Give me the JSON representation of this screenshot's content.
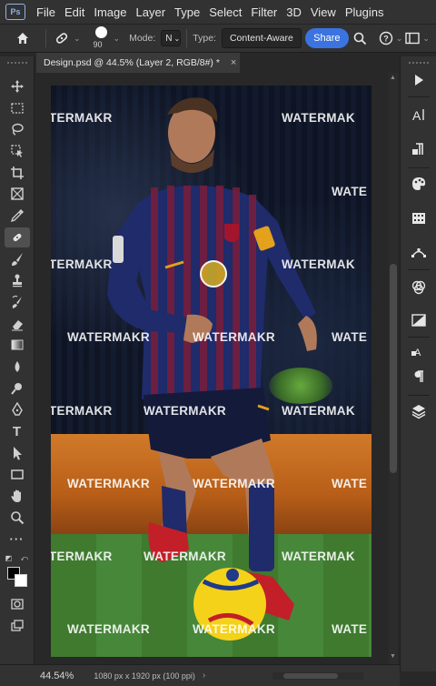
{
  "menubar": {
    "app_icon": "photoshop-logo",
    "items": [
      "File",
      "Edit",
      "Image",
      "Layer",
      "Type",
      "Select",
      "Filter",
      "3D",
      "View",
      "Plugins"
    ]
  },
  "options": {
    "brush_size": "90",
    "mode_label": "Mode:",
    "mode_value": "N",
    "type_label": "Type:",
    "type_value": "Content-Aware",
    "share_label": "Share"
  },
  "document": {
    "tab_title": "Design.psd @ 44.5% (Layer 2, RGB/8#) *",
    "close_glyph": "×"
  },
  "canvas": {
    "watermarks": [
      "TERMAKR",
      "WATERMAK",
      "WATE",
      "TERMAKR",
      "WATERMAK",
      "WATERMAKR",
      "WATERMAKR",
      "WATE",
      "TERMAKR",
      "WATERMAKR",
      "WATERMAK",
      "WATERMAKR",
      "WATERMAKR",
      "WATE",
      "TERMAKR",
      "WATERMAKR",
      "WATERMAK",
      "WATERMAKR",
      "WATERMAKR",
      "WATE"
    ]
  },
  "status": {
    "zoom": "44.54%",
    "doc_info": "1080 px x 1920 px (100 ppi)"
  },
  "colors": {
    "accent": "#3b73e0",
    "foreground": "#000000",
    "background": "#ffffff"
  }
}
